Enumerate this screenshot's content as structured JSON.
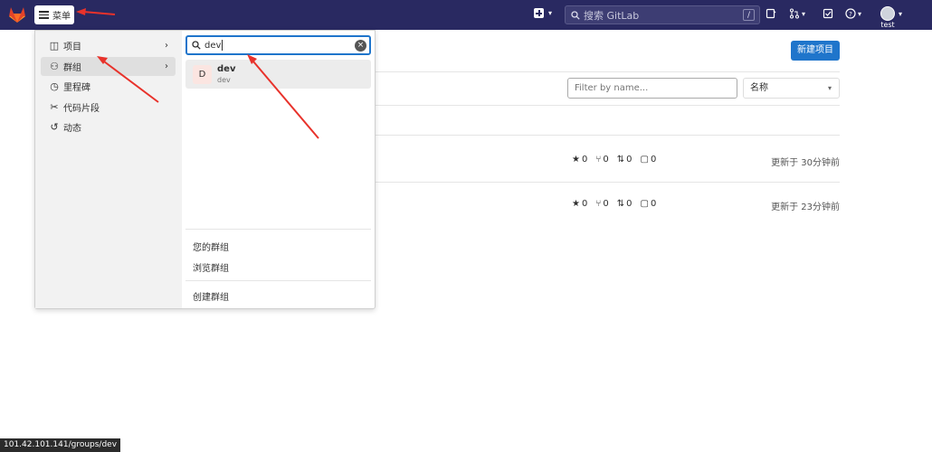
{
  "topbar": {
    "menu_label": "菜单",
    "search_placeholder": "搜索 GitLab",
    "search_shortcut": "/",
    "user_name": "test"
  },
  "page": {
    "new_project_label": "新建项目",
    "filter_placeholder": "Filter by name...",
    "sort_value": "名称",
    "rows": [
      {
        "stars": "0",
        "forks": "0",
        "merge_requests": "0",
        "issues": "0",
        "updated": "更新于 30分钟前"
      },
      {
        "stars": "0",
        "forks": "0",
        "merge_requests": "0",
        "issues": "0",
        "updated": "更新于 23分钟前"
      }
    ]
  },
  "dropdown": {
    "nav": [
      {
        "label": "项目",
        "icon": "project-icon",
        "has_arrow": true
      },
      {
        "label": "群组",
        "icon": "group-icon",
        "has_arrow": true,
        "active": true
      },
      {
        "label": "里程碑",
        "icon": "clock-icon"
      },
      {
        "label": "代码片段",
        "icon": "scissors-icon"
      },
      {
        "label": "动态",
        "icon": "history-icon"
      }
    ],
    "search_value": "dev",
    "result": {
      "initial": "D",
      "name": "dev",
      "path": "dev"
    },
    "links": [
      "您的群组",
      "浏览群组",
      "创建群组"
    ]
  },
  "status_url": "101.42.101.141/groups/dev",
  "colors": {
    "topbar": "#292961",
    "primary": "#1f75cb",
    "arrow": "#e8322b"
  }
}
